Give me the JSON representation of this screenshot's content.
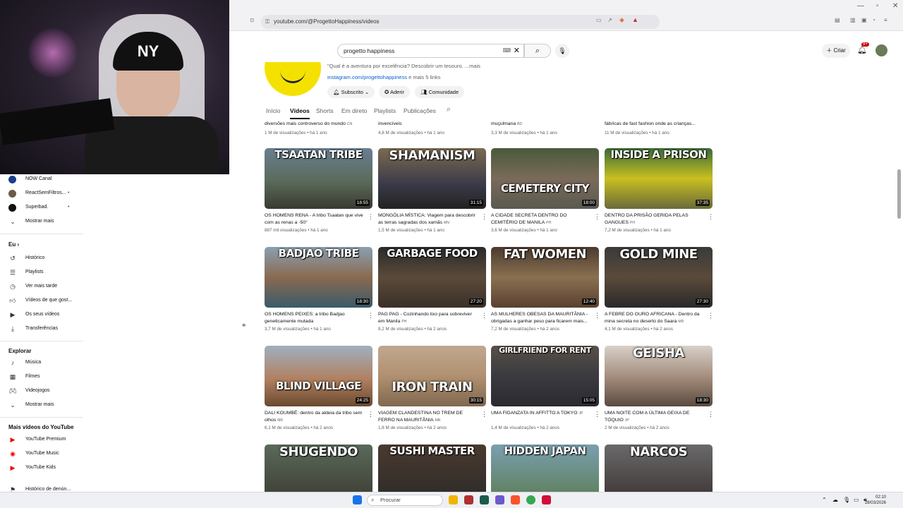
{
  "browser": {
    "url": "youtube.com/@ProgettoHappiness/videos"
  },
  "header": {
    "search_value": "progetto happiness",
    "create_label": "Criar",
    "notif_badge": "9+"
  },
  "channel": {
    "description": "\"Qual é a aventura por excelência? Descobrir um tesouro. ...mais",
    "link_text": "instagram.com/progettohappiness",
    "more_links": " e mais 5 links",
    "subscribed_label": "Subscrito",
    "join_label": "Aderir",
    "community_label": "Comunidade"
  },
  "tabs": [
    "Início",
    "Vídeos",
    "Shorts",
    "Em direto",
    "Playlists",
    "Publicações"
  ],
  "sidebar": {
    "channels": [
      {
        "name": "NOW Canal",
        "color": "#1c3f8a"
      },
      {
        "name": "ReactSemFiltros...",
        "color": "#6b5a4a"
      },
      {
        "name": "Superbad.",
        "color": "#111111"
      }
    ],
    "show_more": "Mostrar mais",
    "you_heading": "Eu",
    "you_items": [
      "Histórico",
      "Playlists",
      "Ver mais tarde",
      "Vídeos de que gost...",
      "Os seus vídeos",
      "Transferências"
    ],
    "explore_heading": "Explorar",
    "explore_items": [
      "Música",
      "Filmes",
      "Videojogos",
      "Mostrar mais"
    ],
    "more_heading": "Mais vídeos do YouTube",
    "more_items": [
      "YouTube Premium",
      "YouTube Music",
      "YouTube Kids"
    ],
    "last_item": "Histórico de denún..."
  },
  "partial_row": [
    {
      "title": "diversões mais controverso do mundo",
      "tag": "CN",
      "meta": "1 M de visualizações • há 1 ano"
    },
    {
      "title": "invencíveis",
      "tag": "",
      "meta": "4,8 M de visualizações • há 1 ano"
    },
    {
      "title": "muçulmana",
      "tag": "BD",
      "meta": "3,3 M de visualizações • há 1 ano"
    },
    {
      "title": "fábricas de fast fashion onde as crianças...",
      "tag": "",
      "meta": "11 M de visualizações • há 1 ano"
    }
  ],
  "videos": [
    {
      "thumb_text": "TSAATAN TRIBE",
      "duration": "18:55",
      "title": "OS HOMENS RENA - A tribo Tsaatan que vive com as renas a -50°",
      "tag": "",
      "meta": "887 mil visualizações • há 1 ano",
      "bg": "linear-gradient(180deg,#6a7f90 0%,#5a6a5a 55%,#3a3a30 100%)"
    },
    {
      "thumb_text": "SHAMANISM",
      "duration": "31:15",
      "title": "MONGÓLIA MÍSTICA: Viagem para descobrir as terras sagradas dos xamãs",
      "tag": "MN",
      "meta": "1,5 M de visualizações • há 1 ano",
      "bg": "linear-gradient(180deg,#7a6a50 0%,#3a3a48 60%,#222 100%)"
    },
    {
      "thumb_text": "CEMETERY CITY",
      "duration": "18:00",
      "title": "A CIDADE SECRETA DENTRO DO CEMITÉRIO DE MANILA",
      "tag": "PH",
      "meta": "3,6 M de visualizações • há 1 ano",
      "bg": "linear-gradient(180deg,#4a5a3a 0%,#7a6a5a 50%,#5a5a50 100%)"
    },
    {
      "thumb_text": "INSIDE A PRISON",
      "duration": "37:35",
      "title": "DENTRO DA PRISÃO GERIDA PELAS GANGUES",
      "tag": "PH",
      "meta": "7,2 M de visualizações • há 1 ano",
      "bg": "linear-gradient(180deg,#3a6a3a 0%,#c8c020 50%,#6a6a3a 100%)"
    },
    {
      "thumb_text": "BADJAO TRIBE",
      "duration": "18:30",
      "title": "OS HOMENS PEIXES: a tribo Badjao geneticamente mutada",
      "tag": "",
      "meta": "3,7 M de visualizações • há 1 ano",
      "bg": "linear-gradient(180deg,#8aa0b0 0%,#8a6a50 50%,#3a5a6a 100%)"
    },
    {
      "thumb_text": "GARBAGE FOOD",
      "duration": "27:20",
      "title": "PAG PAG - Cozinhando lixo para sobreviver em Manila",
      "tag": "PH",
      "meta": "8,2 M de visualizações • há 2 anos",
      "bg": "linear-gradient(180deg,#2a2a2a 0%,#5a4a3a 50%,#3a3028 100%)"
    },
    {
      "thumb_text": "FAT WOMEN",
      "duration": "12:40",
      "title": "AS MULHERES OBESAS DA MAURITÂNIA - obrigadas a ganhar peso para ficarem mais...",
      "tag": "",
      "meta": "7,2 M de visualizações • há 2 anos",
      "bg": "linear-gradient(180deg,#4a3a30 0%,#8a7050 50%,#5a4030 100%)"
    },
    {
      "thumb_text": "GOLD MINE",
      "duration": "27:30",
      "title": "A FEBRE DO OURO AFRICANA - Dentro da mina secreta no deserto do Saara",
      "tag": "MR",
      "meta": "4,1 M de visualizações • há 2 anos",
      "bg": "linear-gradient(180deg,#3a3a3a 0%,#5a4a3a 50%,#2a2a2a 100%)"
    },
    {
      "thumb_text": "BLIND VILLAGE",
      "duration": "24:25",
      "title": "DALI KOUMBÉ: dentro da aldeia da tribo sem olhos",
      "tag": "MR",
      "meta": "6,1 M de visualizações • há 2 anos",
      "bg": "linear-gradient(180deg,#a0b0c0 0%,#b08060 55%,#6a4a30 100%)"
    },
    {
      "thumb_text": "IRON TRAIN",
      "duration": "30:15",
      "title": "VIAGEM CLANDESTINA NO TREM DE FERRO NA MAURITÂNIA",
      "tag": "MR",
      "meta": "1,6 M de visualizações • há 2 anos",
      "bg": "linear-gradient(180deg,#c0a890 0%,#b09070 50%,#806850 100%)"
    },
    {
      "thumb_text": "GIRLFRIEND FOR RENT",
      "duration": "15:05",
      "title": "UMA FIDANZATA IN AFFITTO A TOKYO",
      "tag": "JP",
      "meta": "1,4 M de visualizações • há 2 anos",
      "bg": "linear-gradient(180deg,#5a5048 0%,#3a3a40 50%,#2a2a30 100%)"
    },
    {
      "thumb_text": "GEISHA",
      "duration": "18:30",
      "title": "UMA NOITE COM A ÚLTIMA GEIXA DE TÓQUIO",
      "tag": "JP",
      "meta": "2 M de visualizações • há 2 anos",
      "bg": "linear-gradient(180deg,#d8d0c8 0%,#a08878 55%,#5a4a40 100%)"
    },
    {
      "thumb_text": "SHUGENDO",
      "duration": "",
      "title": "",
      "tag": "",
      "meta": "",
      "bg": "linear-gradient(180deg,#5a6a5a 0%,#3a3a30 100%)"
    },
    {
      "thumb_text": "SUSHI MASTER",
      "duration": "",
      "title": "",
      "tag": "",
      "meta": "",
      "bg": "linear-gradient(180deg,#4a3a30 0%,#2a2a28 100%)"
    },
    {
      "thumb_text": "HIDDEN JAPAN",
      "duration": "",
      "title": "",
      "tag": "",
      "meta": "",
      "bg": "linear-gradient(180deg,#7aa0b0 0%,#5a7a50 100%)"
    },
    {
      "thumb_text": "NARCOS",
      "duration": "",
      "title": "",
      "tag": "",
      "meta": "",
      "bg": "linear-gradient(180deg,#6a6a6a 0%,#3a3030 100%)"
    }
  ],
  "taskbar": {
    "search_placeholder": "Procurar",
    "time": "02:10",
    "date": "28/03/2026"
  }
}
